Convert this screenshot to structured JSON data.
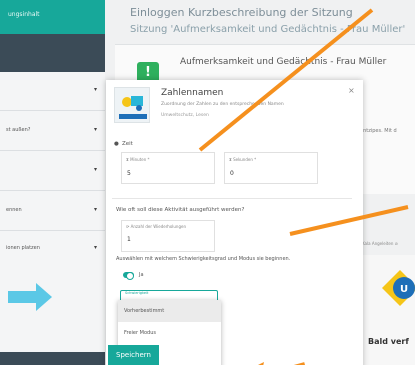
{
  "sidebar": {
    "header_text": "ungsinhalt",
    "items": [
      {
        "label": ""
      },
      {
        "label": "st außen?"
      },
      {
        "label": ""
      },
      {
        "label": "ennen"
      },
      {
        "label": "ionen platzen"
      }
    ],
    "chevron": "▾"
  },
  "background": {
    "title_line1": "Einloggen Kurzbeschreibung der Sitzung",
    "title_line2": "Sitzung 'Aufmerksamkeit und Gedächtnis - Frau Müller'",
    "card_title": "Aufmerksamkeit und Gedächtnis - Frau Müller",
    "right_text": "entzipes. Mit d",
    "right_text2": "Kala Angeleiten ⊘",
    "card2_title": "Bald verf"
  },
  "modal": {
    "title": "Zahlennamen",
    "description": "Zuordnung der Zahlen zu den entsprechenden Namen",
    "duration": "Umweltschutz, Lesen",
    "close": "×",
    "time_section": "Zeit",
    "minutes_label": "⧗ Minuten *",
    "minutes_value": "5",
    "seconds_label": "⧗ Sekunden *",
    "seconds_value": "0",
    "repeat_section": "Wie oft soll diese Aktivität ausgeführt werden?",
    "repeat_label": "⟳ Anzahl der Wiederholungen",
    "repeat_value": "1",
    "difficulty_section": "Auswählen mit welchem Schwierigkeitsgrad und Modus sie beginnen.",
    "toggle_label": "Ja",
    "select_label": "Schwierigkeit",
    "options": [
      "Vorherbestimmt",
      "Freier Modus"
    ],
    "save_label": "Speichern"
  },
  "colors": {
    "accent": "#17a89a",
    "sidebar": "#3b4b57",
    "overlay_arrow": "#f5901e",
    "overlay_arrow_left": "#5bc8e6"
  }
}
